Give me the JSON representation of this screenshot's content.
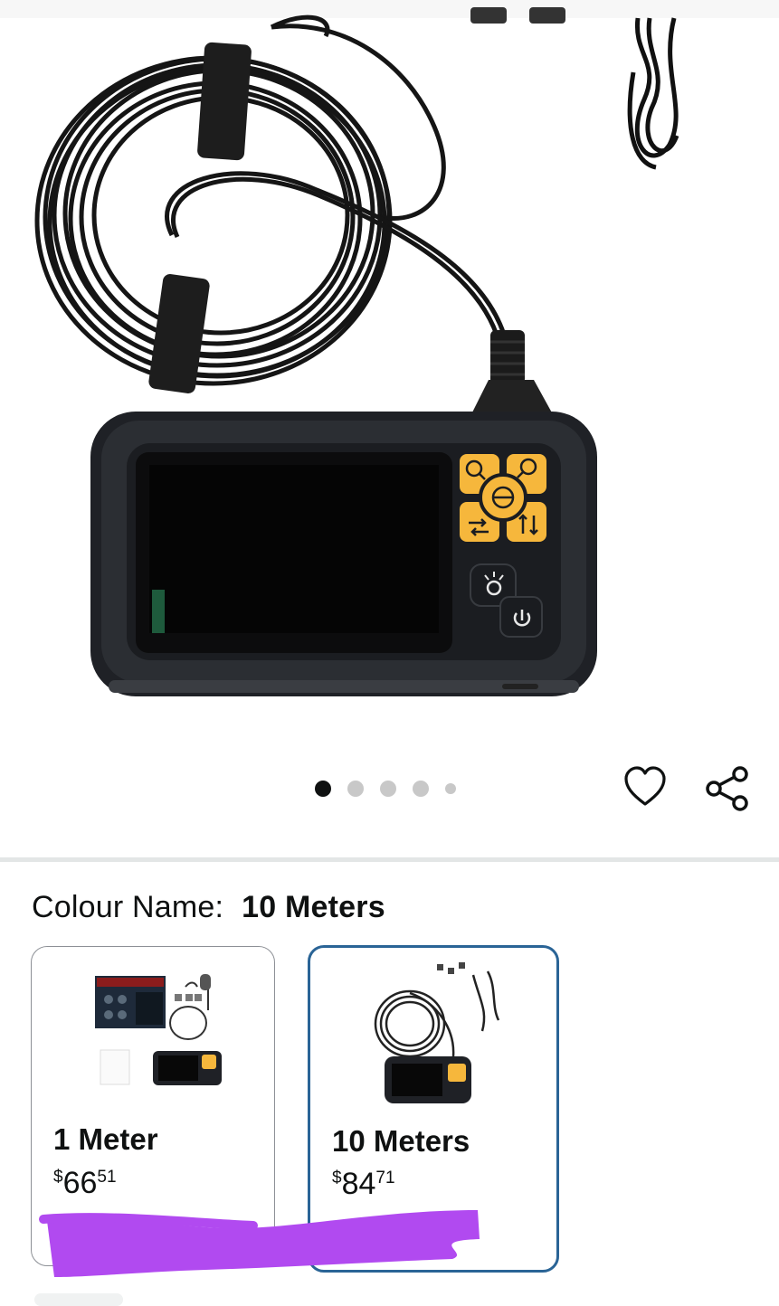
{
  "gallery": {
    "image_alt": "Industrial endoscope inspection camera with 10 meter cable",
    "dots_count": 5,
    "active_dot_index": 0,
    "wishlist_icon": "heart-icon",
    "share_icon": "share-icon"
  },
  "variation": {
    "label": "Colour Name:",
    "selected": "10 Meters",
    "options": [
      {
        "title": "1 Meter",
        "price_symbol": "$",
        "price_whole": "66",
        "price_fraction": "51",
        "selected": false
      },
      {
        "title": "10 Meters",
        "price_symbol": "$",
        "price_whole": "84",
        "price_fraction": "71",
        "selected": true
      }
    ]
  },
  "colors": {
    "selected_border": "#2a6496",
    "scribble": "#b14af0",
    "camera_button": "#f6b73c"
  }
}
